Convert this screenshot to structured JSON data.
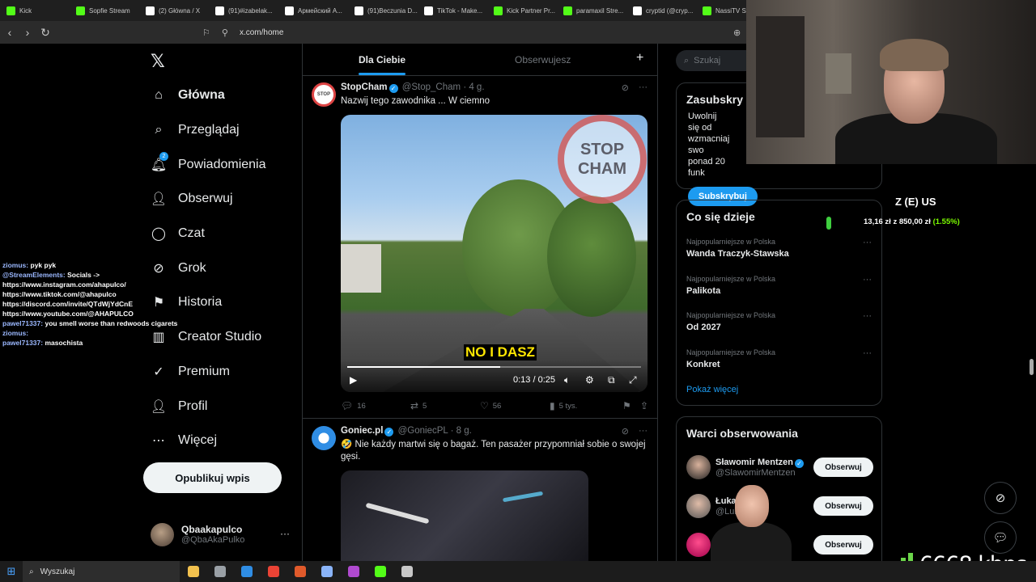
{
  "browser": {
    "tabs": [
      {
        "label": "Kick",
        "color": "#53fc18"
      },
      {
        "label": "Sopfie Stream",
        "color": "#53fc18"
      },
      {
        "label": "(2) Główna / X",
        "color": "#ffffff"
      },
      {
        "label": "(91)#izabelak...",
        "color": "#ffffff"
      },
      {
        "label": "Армейский А...",
        "color": "#ffffff"
      },
      {
        "label": "(91)Beczunia D...",
        "color": "#ffffff"
      },
      {
        "label": "TikTok - Make...",
        "color": "#ffffff"
      },
      {
        "label": "Kick Partner Pr...",
        "color": "#53fc18"
      },
      {
        "label": "paramaxil Stre...",
        "color": "#53fc18"
      },
      {
        "label": "cryptid (@cryp...",
        "color": "#ffffff"
      },
      {
        "label": "NassiTV St...",
        "color": "#53fc18"
      }
    ],
    "url": "x.com/home"
  },
  "nav": {
    "logo": "𝕏",
    "items": [
      {
        "label": "Główna",
        "icon": "home-icon",
        "glyph": "⌂"
      },
      {
        "label": "Przeglądaj",
        "icon": "search-icon",
        "glyph": "⌕"
      },
      {
        "label": "Powiadomienia",
        "icon": "bell-icon",
        "glyph": "🔔︎",
        "badge": "2"
      },
      {
        "label": "Obserwuj",
        "icon": "follow-icon",
        "glyph": "👤︎"
      },
      {
        "label": "Czat",
        "icon": "chat-icon",
        "glyph": "◯"
      },
      {
        "label": "Grok",
        "icon": "grok-icon",
        "glyph": "⊘"
      },
      {
        "label": "Historia",
        "icon": "bookmark-icon",
        "glyph": "⚑"
      },
      {
        "label": "Creator Studio",
        "icon": "creator-studio-icon",
        "glyph": "▥"
      },
      {
        "label": "Premium",
        "icon": "premium-icon",
        "glyph": "✓"
      },
      {
        "label": "Profil",
        "icon": "profile-icon",
        "glyph": "👤︎"
      },
      {
        "label": "Więcej",
        "icon": "more-icon",
        "glyph": "⋯"
      }
    ],
    "post_button": "Opublikuj wpis",
    "account": {
      "name": "Qbaakapulco",
      "handle": "@QbaAkaPulko"
    }
  },
  "chat": {
    "lines": [
      {
        "user": "ziomus:",
        "text": "pyk pyk"
      },
      {
        "user": "@StreamElements:",
        "text": "Socials ->"
      },
      {
        "user": "",
        "text": "https://www.instagram.com/ahapulco/"
      },
      {
        "user": "",
        "text": "https://www.tiktok.com/@ahapulco"
      },
      {
        "user": "",
        "text": "https://discord.com/invite/QTdWjYdCnE"
      },
      {
        "user": "",
        "text": "https://www.youtube.com/@AHAPULCO"
      },
      {
        "user": "pawel71337:",
        "text": "you smell worse than redwoods cigarets"
      },
      {
        "user": "ziomus:",
        "text": ""
      },
      {
        "user": "pawel71337:",
        "text": "masochista"
      }
    ]
  },
  "feed": {
    "tab_for_you": "Dla Ciebie",
    "tab_following": "Obserwujesz",
    "post1": {
      "name": "StopCham",
      "handle": "@Stop_Cham",
      "time": "· 4 g.",
      "text": "Nazwij tego zawodnika ... W ciemno",
      "video": {
        "stamp_line1": "STOP",
        "stamp_line2": "CHAM",
        "caption": "NO I DASZ",
        "time": "0:13 / 0:25",
        "progress": 0.52
      },
      "replies": "16",
      "reposts": "5",
      "likes": "56",
      "views": "5 tys."
    },
    "post2": {
      "name": "Goniec.pl",
      "handle": "@GoniecPL",
      "time": "· 8 g.",
      "text": "🤣 Nie każdy martwi się o bagaż. Ten pasażer przypomniał sobie o swojej gęsi."
    }
  },
  "sidebar": {
    "search_placeholder": "Szukaj",
    "subscribe": {
      "title": "Zasubskry",
      "text": "Uwolnij się od wzmacniaj swo ponad 20 funk",
      "button": "Subskrybuj"
    },
    "trends": {
      "title": "Co się dzieje",
      "items": [
        {
          "context": "Najpopularniejsze w Polska",
          "name": "Wanda Traczyk-Stawska"
        },
        {
          "context": "Najpopularniejsze w Polska",
          "name": "Palikota"
        },
        {
          "context": "Najpopularniejsze w Polska",
          "name": "Od 2027"
        },
        {
          "context": "Najpopularniejsze w Polska",
          "name": "Konkret"
        }
      ],
      "show_more": "Pokaż więcej"
    },
    "who_to_follow": {
      "title": "Warci obserwowania",
      "items": [
        {
          "name": "Sławomir Mentzen",
          "handle": "@SlawomirMentzen",
          "button": "Obserwuj"
        },
        {
          "name": "Łukas",
          "handle": "@Luk",
          "button": "Obserwuj"
        },
        {
          "name": "",
          "handle": "",
          "button": "Obserwuj"
        }
      ]
    }
  },
  "overlay": {
    "stock_title": "Z (E) US",
    "stock_price": "13,16 zł",
    "stock_z": "z",
    "stock_target": "850,00 zł",
    "stock_change": "(1.55%)",
    "kbps": "6668 kbps"
  },
  "taskbar": {
    "search": "Wyszukaj",
    "apps": [
      "#f2c14e",
      "#9aa0a6",
      "#2f8de4",
      "#ea4335",
      "#e05a2b",
      "#8ab4f8",
      "#b04ad0",
      "#53fc18",
      "#c7c7c7"
    ]
  }
}
